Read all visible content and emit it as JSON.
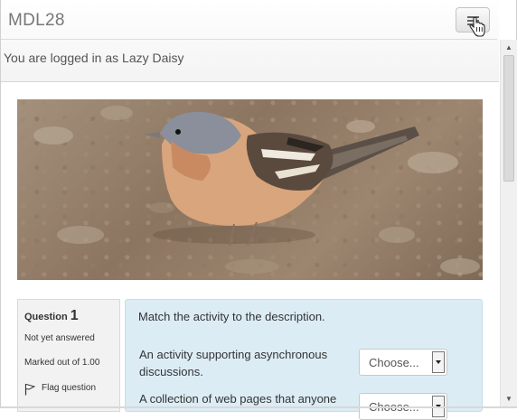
{
  "header": {
    "site_name": "MDL28",
    "login_info": "You are logged in as Lazy Daisy",
    "menu_toggle_icon": "hamburger-icon",
    "cursor_icon": "hand-pointer-icon"
  },
  "banner": {
    "icon": "bird-photo"
  },
  "question_info": {
    "label": "Question",
    "number": "1",
    "state": "Not yet answered",
    "mark": "Marked out of 1.00",
    "flag_label": "Flag question",
    "flag_icon": "flag-icon"
  },
  "question": {
    "prompt": "Match the activity to the description.",
    "items": [
      {
        "text": "An activity supporting asynchronous discussions.",
        "selected": "Choose..."
      },
      {
        "text": "A collection of web pages that anyone",
        "selected": "Choose..."
      }
    ]
  },
  "colors": {
    "question_bg": "#dcecf5",
    "info_bg": "#f2f2f2"
  }
}
